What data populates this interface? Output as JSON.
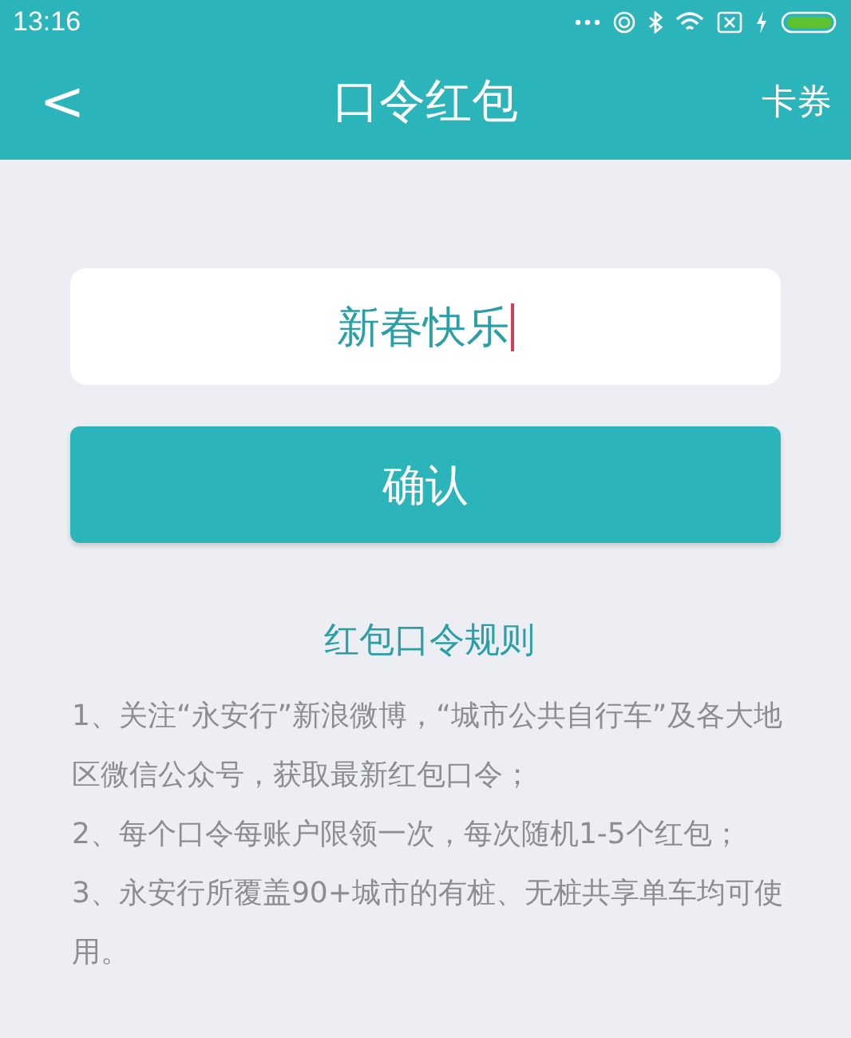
{
  "status_bar": {
    "time": "13:16"
  },
  "nav": {
    "back": "<",
    "title": "口令红包",
    "action": "卡券"
  },
  "code_field": {
    "value": "新春快乐",
    "focused": true
  },
  "confirm_button": {
    "label": "确认"
  },
  "rules": {
    "title": "红包口令规则",
    "items": [
      "1、关注“永安行”新浪微博，“城市公共自行车”及各大地区微信公众号，获取最新红包口令；",
      "2、每个口令每账户限领一次，每次随机1-5个红包；",
      "3、永安行所覆盖90+城市的有桩、无桩共享单车均可使用。"
    ]
  }
}
